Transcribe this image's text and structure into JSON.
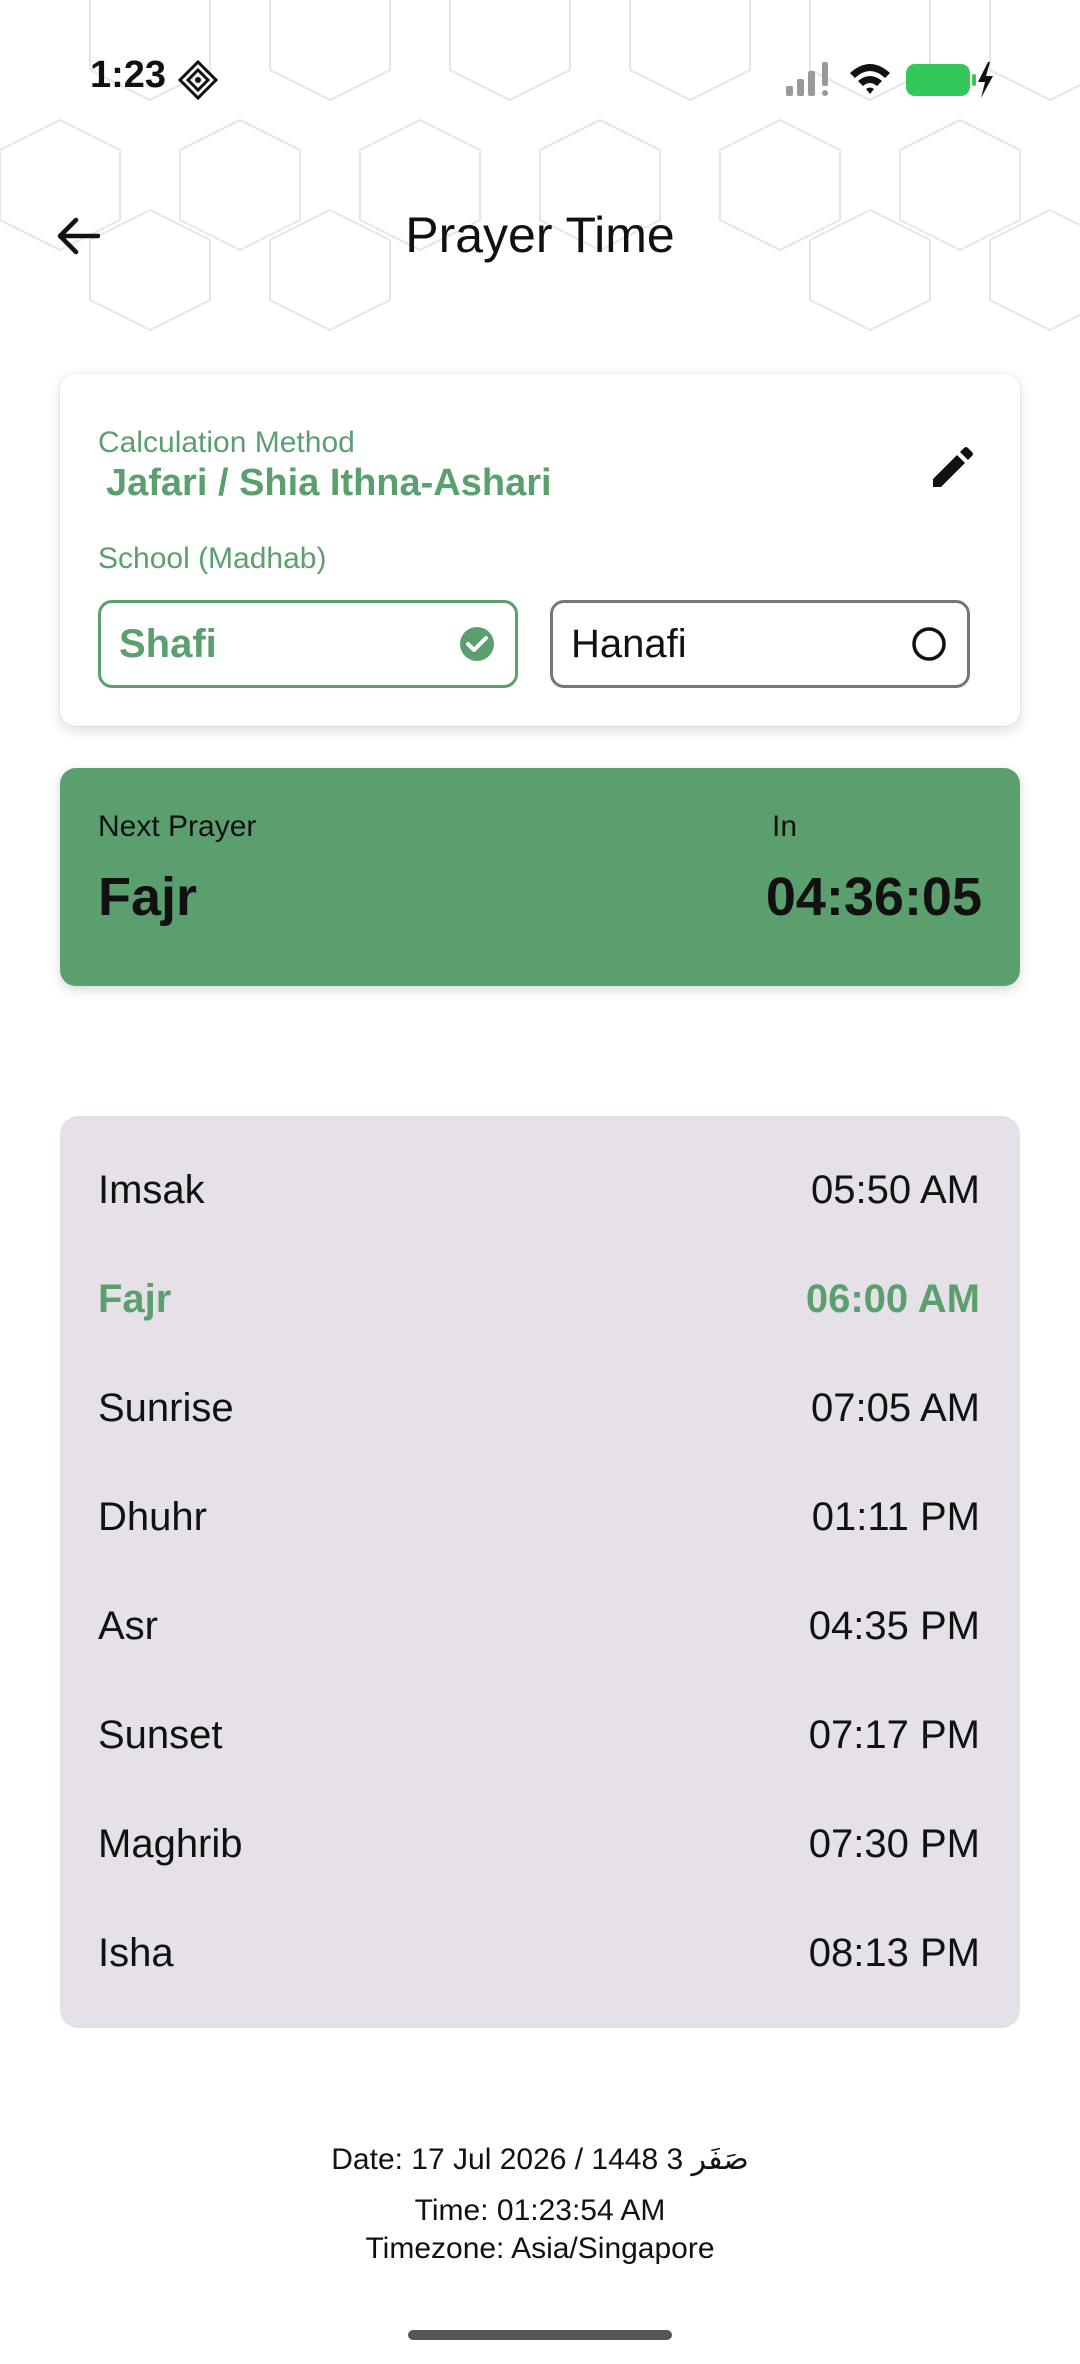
{
  "status_bar": {
    "time": "1:23"
  },
  "header": {
    "title": "Prayer Time"
  },
  "method_card": {
    "method_label": "Calculation Method",
    "method_value": "Jafari / Shia Ithna-Ashari",
    "school_label": "School (Madhab)",
    "schools": [
      {
        "label": "Shafi",
        "selected": true
      },
      {
        "label": "Hanafi",
        "selected": false
      }
    ]
  },
  "next_prayer": {
    "label": "Next Prayer",
    "name": "Fajr",
    "in_label": "In",
    "countdown": "04:36:05"
  },
  "prayer_times": [
    {
      "name": "Imsak",
      "time": "05:50 AM",
      "active": false
    },
    {
      "name": "Fajr",
      "time": "06:00 AM",
      "active": true
    },
    {
      "name": "Sunrise",
      "time": "07:05 AM",
      "active": false
    },
    {
      "name": "Dhuhr",
      "time": "01:11 PM",
      "active": false
    },
    {
      "name": "Asr",
      "time": "04:35 PM",
      "active": false
    },
    {
      "name": "Sunset",
      "time": "07:17 PM",
      "active": false
    },
    {
      "name": "Maghrib",
      "time": "07:30 PM",
      "active": false
    },
    {
      "name": "Isha",
      "time": "08:13 PM",
      "active": false
    }
  ],
  "footer": {
    "date": "Date: 17 Jul 2026 / 1448 3 صَفَر",
    "time": "Time: 01:23:54 AM",
    "timezone": "Timezone: Asia/Singapore"
  },
  "colors": {
    "accent": "#5b9f6f",
    "list_bg": "#e6e1e8",
    "battery": "#34c759"
  },
  "icons": {
    "back": "arrow-left-icon",
    "edit": "pencil-icon",
    "selected": "check-circle-icon",
    "unselected": "radio-empty-icon"
  }
}
